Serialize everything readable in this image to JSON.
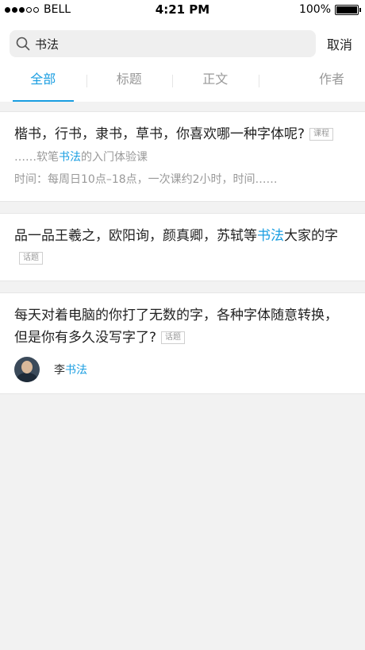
{
  "status_bar": {
    "carrier": "BELL",
    "time": "4:21 PM",
    "battery": "100%"
  },
  "search": {
    "value": "书法",
    "cancel_label": "取消"
  },
  "tabs": [
    {
      "label": "全部",
      "active": true
    },
    {
      "label": "标题",
      "active": false
    },
    {
      "label": "正文",
      "active": false
    },
    {
      "label": "作者",
      "active": false
    }
  ],
  "results": [
    {
      "title": "楷书，行书，隶书，草书，你喜欢哪一种字体呢?",
      "tag": "课程",
      "excerpt_prefix": "……软笔",
      "excerpt_highlight": "书法",
      "excerpt_suffix": "的入门体验课",
      "meta": "时间：每周日10点–18点，一次课约2小时，时间……"
    },
    {
      "title_prefix": "品一品王羲之，欧阳询，颜真卿，苏轼等",
      "title_highlight": "书法",
      "title_suffix": "大家的字",
      "tag": "话题"
    },
    {
      "title": "每天对着电脑的你打了无数的字，各种字体随意转换，但是你有多久没写字了?",
      "tag": "话题",
      "author_prefix": "李",
      "author_highlight": "书法"
    }
  ],
  "colors": {
    "accent": "#1a9ee1",
    "background": "#f2f2f2"
  }
}
